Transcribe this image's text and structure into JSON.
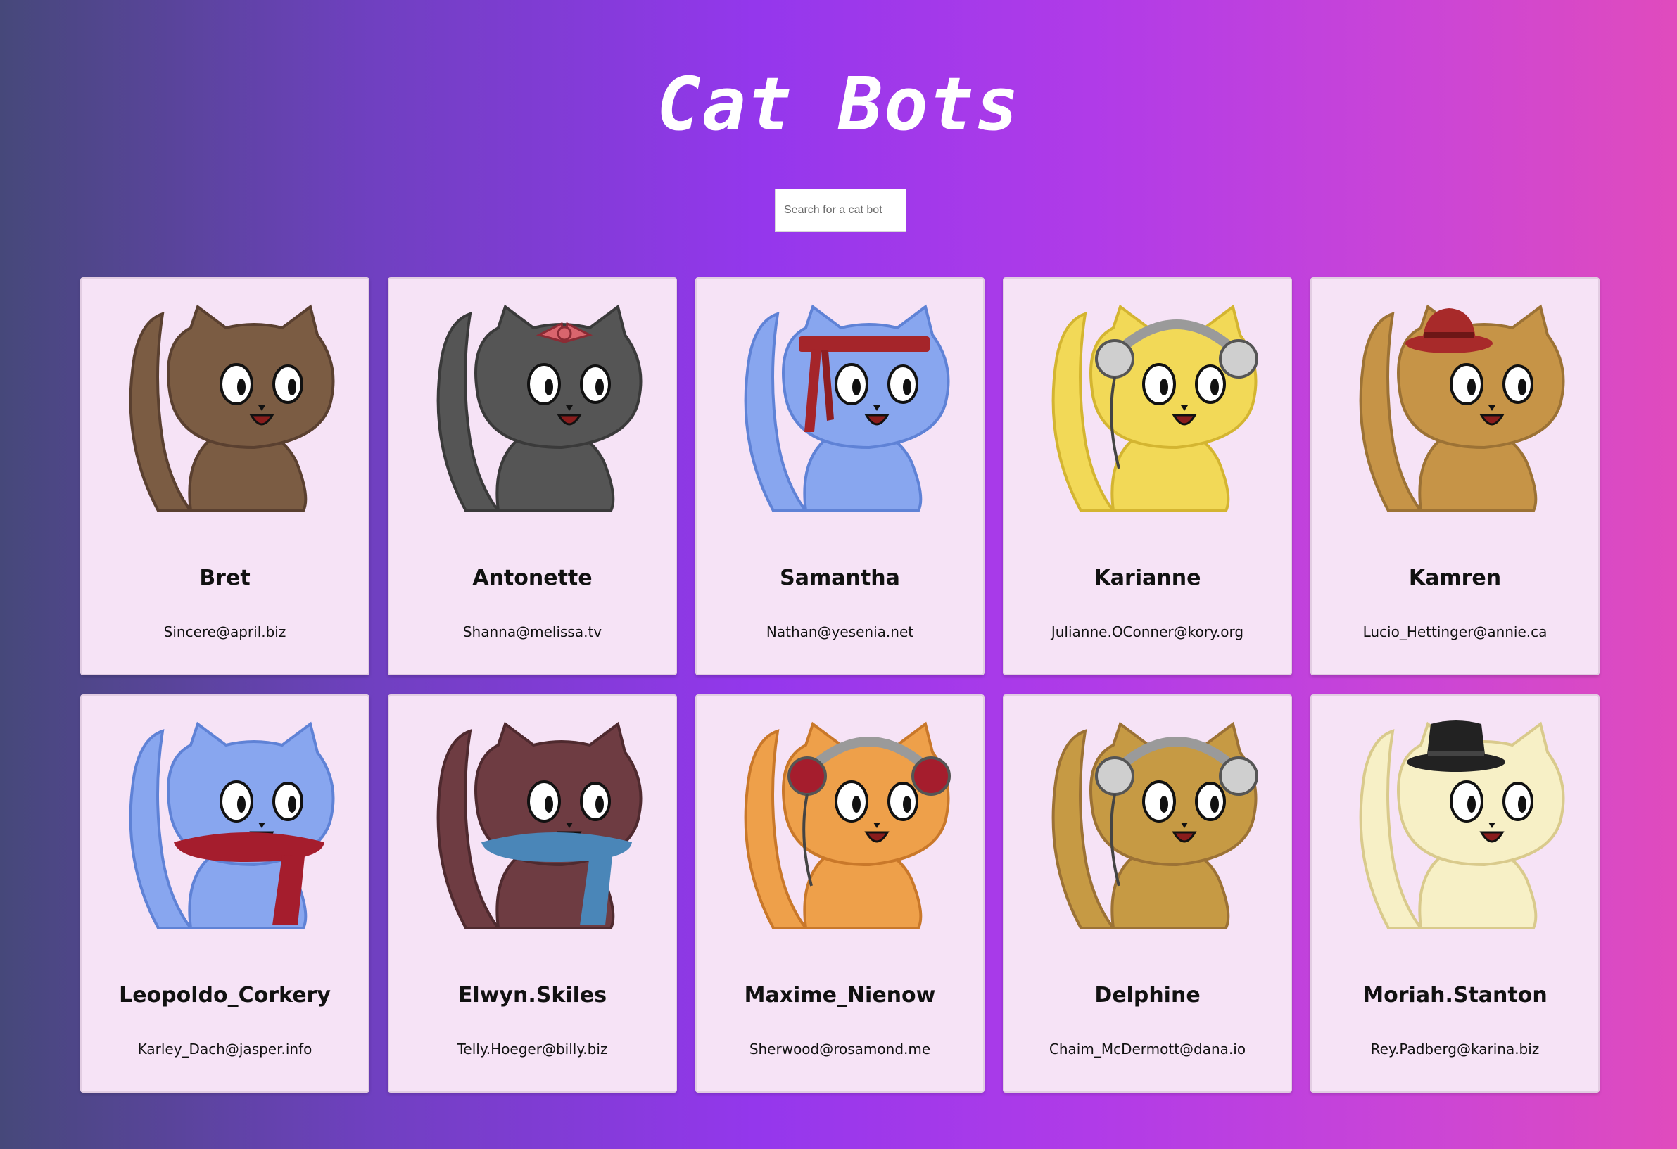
{
  "app": {
    "title": "Cat Bots"
  },
  "search": {
    "placeholder": "Search for a cat bot"
  },
  "cats": [
    {
      "name": "Bret",
      "email": "Sincere@april.biz",
      "body": "#7b5c43",
      "stroke": "#5a4030",
      "accent": "none",
      "accessory": "none"
    },
    {
      "name": "Antonette",
      "email": "Shanna@melissa.tv",
      "body": "#555555",
      "stroke": "#3a3a3a",
      "accent": "#d9656d",
      "accessory": "bow"
    },
    {
      "name": "Samantha",
      "email": "Nathan@yesenia.net",
      "body": "#88a6ef",
      "stroke": "#5f82d6",
      "accent": "#a5252a",
      "accessory": "headband"
    },
    {
      "name": "Karianne",
      "email": "Julianne.OConner@kory.org",
      "body": "#f2d957",
      "stroke": "#d4b531",
      "accent": "#b9b9b9",
      "accessory": "headset"
    },
    {
      "name": "Kamren",
      "email": "Lucio_Hettinger@annie.ca",
      "body": "#c69447",
      "stroke": "#9c7235",
      "accent": "#a82a2a",
      "accessory": "fedora"
    },
    {
      "name": "Leopoldo_Corkery",
      "email": "Karley_Dach@jasper.info",
      "body": "#88a6ef",
      "stroke": "#5f82d6",
      "accent": "#a51d2d",
      "accessory": "scarf"
    },
    {
      "name": "Elwyn.Skiles",
      "email": "Telly.Hoeger@billy.biz",
      "body": "#6e3c42",
      "stroke": "#4f2a2f",
      "accent": "#4a86b8",
      "accessory": "scarf"
    },
    {
      "name": "Maxime_Nienow",
      "email": "Sherwood@rosamond.me",
      "body": "#eea04a",
      "stroke": "#c9782a",
      "accent": "#a51d2d",
      "accessory": "headphones"
    },
    {
      "name": "Delphine",
      "email": "Chaim_McDermott@dana.io",
      "body": "#c69a44",
      "stroke": "#9c7235",
      "accent": "#b9b9b9",
      "accessory": "headset"
    },
    {
      "name": "Moriah.Stanton",
      "email": "Rey.Padberg@karina.biz",
      "body": "#f7f0c6",
      "stroke": "#d9ca8c",
      "accent": "#222222",
      "accessory": "tophat"
    }
  ]
}
